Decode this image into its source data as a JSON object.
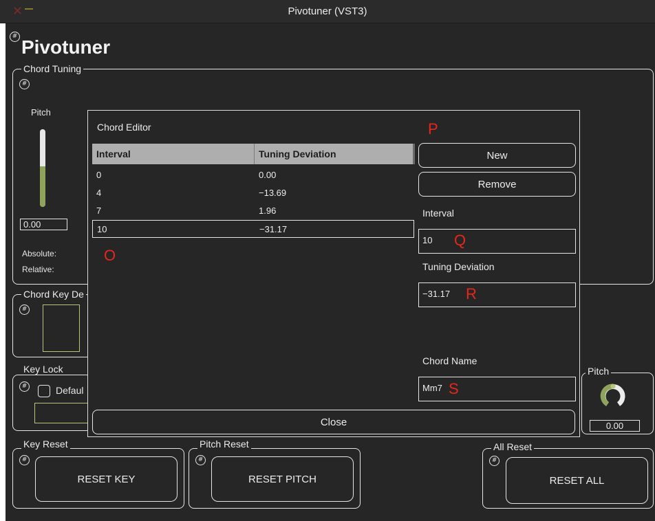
{
  "window": {
    "title": "Pivotuner (VST3)"
  },
  "app": {
    "title": "Pivotuner"
  },
  "chord_tuning": {
    "label": "Chord Tuning",
    "pitch_label": "Pitch",
    "pitch_value": "0.00",
    "pitch_level": 0.52,
    "absolute_label": "Absolute:",
    "relative_label": "Relative:"
  },
  "chord_key": {
    "label": "Chord Key De"
  },
  "key_lock": {
    "label": "Key Lock",
    "checkbox_label": "Defaul"
  },
  "pitch_panel": {
    "label": "Pitch",
    "value": "0.00"
  },
  "key_reset": {
    "label": "Key Reset",
    "button": "RESET KEY"
  },
  "pitch_reset": {
    "label": "Pitch Reset",
    "button": "RESET PITCH"
  },
  "all_reset": {
    "label": "All Reset",
    "button": "RESET ALL"
  },
  "chord_editor": {
    "title": "Chord Editor",
    "columns": [
      "Interval",
      "Tuning Deviation"
    ],
    "rows": [
      {
        "interval": "0",
        "deviation": "0.00"
      },
      {
        "interval": "4",
        "deviation": "−13.69"
      },
      {
        "interval": "7",
        "deviation": "1.96"
      },
      {
        "interval": "10",
        "deviation": "−31.17"
      }
    ],
    "new_button": "New",
    "remove_button": "Remove",
    "interval_label": "Interval",
    "interval_value": "10",
    "deviation_label": "Tuning Deviation",
    "deviation_value": "−31.17",
    "chord_name_label": "Chord Name",
    "chord_name_value": "Mm7",
    "close_button": "Close"
  },
  "annotations": {
    "o": "O",
    "p": "P",
    "q": "Q",
    "r": "R",
    "s": "S"
  },
  "colors": {
    "background": "#262626",
    "border": "#e6e6e6",
    "accent_green": "#8fa35a",
    "annotation_red": "#e8261c",
    "table_header": "#aeaeae"
  },
  "icons": {
    "close": "close-icon",
    "minimize": "minimize-icon",
    "hash": "hash-icon",
    "knob": "pitch-knob-icon"
  }
}
